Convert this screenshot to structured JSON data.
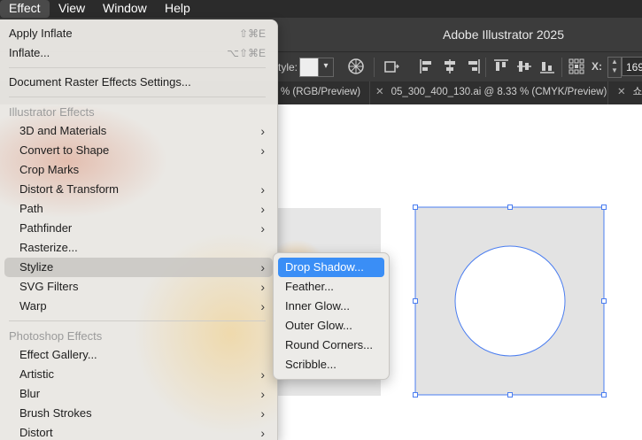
{
  "menubar": {
    "items": [
      "Effect",
      "View",
      "Window",
      "Help"
    ]
  },
  "window": {
    "title": "Adobe Illustrator 2025"
  },
  "toolbar": {
    "style_label": "tyle:",
    "x_label": "X:",
    "x_value": "169"
  },
  "tabs": [
    {
      "label": "% (RGB/Preview)"
    },
    {
      "label": "05_300_400_130.ai @ 8.33 % (CMYK/Preview)"
    },
    {
      "label": "쇼핑"
    }
  ],
  "effect_menu": {
    "top_items": [
      {
        "label": "Apply Inflate",
        "shortcut": "⇧⌘E"
      },
      {
        "label": "Inflate...",
        "shortcut": "⌥⇧⌘E"
      }
    ],
    "raster_settings": "Document Raster Effects Settings...",
    "illustrator_header": "Illustrator Effects",
    "illustrator_items": [
      {
        "label": "3D and Materials",
        "submenu": true
      },
      {
        "label": "Convert to Shape",
        "submenu": true
      },
      {
        "label": "Crop Marks",
        "submenu": false
      },
      {
        "label": "Distort & Transform",
        "submenu": true
      },
      {
        "label": "Path",
        "submenu": true
      },
      {
        "label": "Pathfinder",
        "submenu": true
      },
      {
        "label": "Rasterize...",
        "submenu": false
      },
      {
        "label": "Stylize",
        "submenu": true
      },
      {
        "label": "SVG Filters",
        "submenu": true
      },
      {
        "label": "Warp",
        "submenu": true
      }
    ],
    "photoshop_header": "Photoshop Effects",
    "photoshop_items": [
      {
        "label": "Effect Gallery...",
        "submenu": false
      },
      {
        "label": "Artistic",
        "submenu": true
      },
      {
        "label": "Blur",
        "submenu": true
      },
      {
        "label": "Brush Strokes",
        "submenu": true
      },
      {
        "label": "Distort",
        "submenu": true
      }
    ]
  },
  "stylize_submenu": {
    "items": [
      "Drop Shadow...",
      "Feather...",
      "Inner Glow...",
      "Outer Glow...",
      "Round Corners...",
      "Scribble..."
    ],
    "highlighted": "Drop Shadow..."
  },
  "colors": {
    "accent": "#3a8ef6",
    "selection_stroke": "#4a7df0",
    "artboard_fill": "#e3e3e3"
  }
}
